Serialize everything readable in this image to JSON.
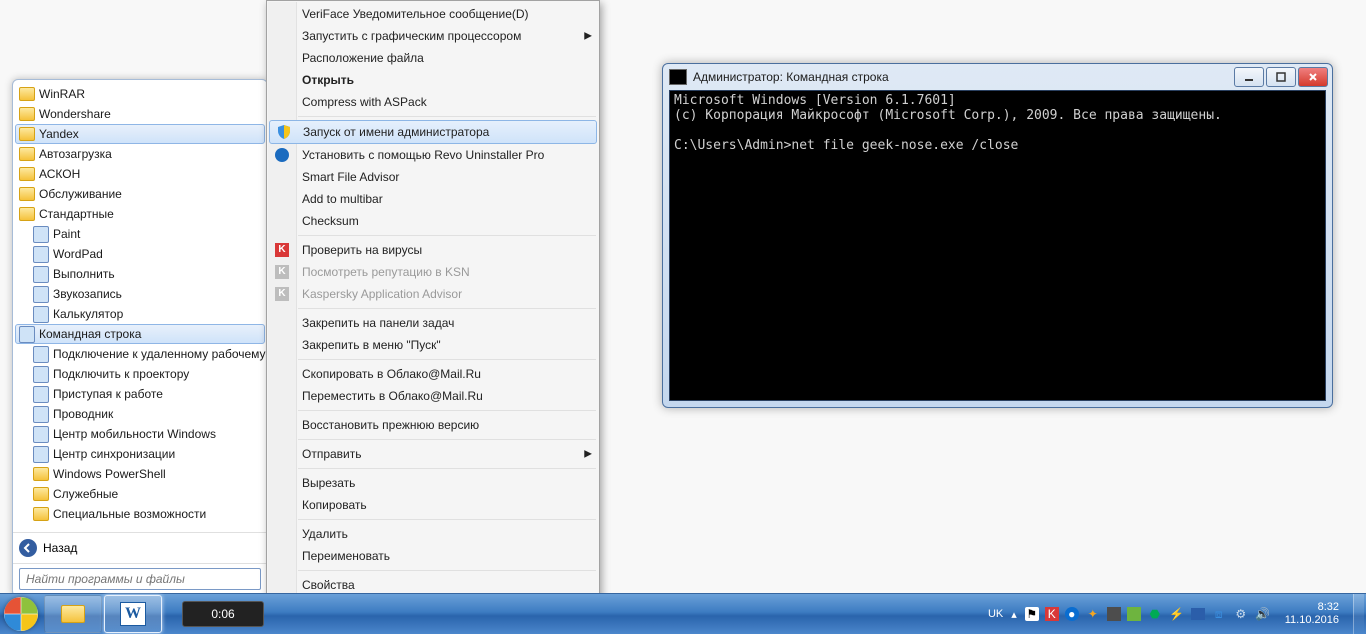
{
  "start_menu": {
    "items": [
      {
        "label": "WinRAR",
        "kind": "folder"
      },
      {
        "label": "Wondershare",
        "kind": "folder"
      },
      {
        "label": "Yandex",
        "kind": "folder",
        "selected": true
      },
      {
        "label": "Автозагрузка",
        "kind": "folder"
      },
      {
        "label": "АСКОН",
        "kind": "folder"
      },
      {
        "label": "Обслуживание",
        "kind": "folder"
      },
      {
        "label": "Стандартные",
        "kind": "folder"
      },
      {
        "label": "Paint",
        "kind": "app",
        "indent": true
      },
      {
        "label": "WordPad",
        "kind": "app",
        "indent": true
      },
      {
        "label": "Выполнить",
        "kind": "app",
        "indent": true
      },
      {
        "label": "Звукозапись",
        "kind": "app",
        "indent": true
      },
      {
        "label": "Калькулятор",
        "kind": "app",
        "indent": true
      },
      {
        "label": "Командная строка",
        "kind": "app",
        "indent": true,
        "selected": true
      },
      {
        "label": "Подключение к удаленному рабочему",
        "kind": "app",
        "indent": true
      },
      {
        "label": "Подключить к проектору",
        "kind": "app",
        "indent": true
      },
      {
        "label": "Приступая к работе",
        "kind": "app",
        "indent": true
      },
      {
        "label": "Проводник",
        "kind": "app",
        "indent": true
      },
      {
        "label": "Центр мобильности Windows",
        "kind": "app",
        "indent": true
      },
      {
        "label": "Центр синхронизации",
        "kind": "app",
        "indent": true
      },
      {
        "label": "Windows PowerShell",
        "kind": "folder",
        "indent": true
      },
      {
        "label": "Служебные",
        "kind": "folder",
        "indent": true
      },
      {
        "label": "Специальные возможности",
        "kind": "folder",
        "indent": true
      }
    ],
    "back_label": "Назад",
    "search_placeholder": "Найти программы и файлы"
  },
  "context_menu": {
    "items": [
      {
        "label": "VeriFace Уведомительное сообщение(D)"
      },
      {
        "label": "Запустить с графическим процессором",
        "submenu": true
      },
      {
        "label": "Расположение файла"
      },
      {
        "label": "Открыть",
        "bold": true
      },
      {
        "label": "Compress with ASPack"
      },
      {
        "sep": true
      },
      {
        "label": "Запуск от имени администратора",
        "highlight": true,
        "icon": "shield-icon"
      },
      {
        "label": "Установить с помощью Revo Uninstaller Pro",
        "icon": "revo-icon"
      },
      {
        "label": "Smart File Advisor"
      },
      {
        "label": "Add to multibar"
      },
      {
        "label": "Checksum"
      },
      {
        "sep": true
      },
      {
        "label": "Проверить на вирусы",
        "icon": "kaspersky-icon"
      },
      {
        "label": "Посмотреть репутацию в KSN",
        "disabled": true,
        "icon": "kaspersky-gray-icon"
      },
      {
        "label": "Kaspersky Application Advisor",
        "disabled": true,
        "icon": "kaspersky-gray-icon"
      },
      {
        "sep": true
      },
      {
        "label": "Закрепить на панели задач"
      },
      {
        "label": "Закрепить в меню \"Пуск\""
      },
      {
        "sep": true
      },
      {
        "label": "Скопировать в Облако@Mail.Ru"
      },
      {
        "label": "Переместить в Облако@Mail.Ru"
      },
      {
        "sep": true
      },
      {
        "label": "Восстановить прежнюю версию"
      },
      {
        "sep": true
      },
      {
        "label": "Отправить",
        "submenu": true
      },
      {
        "sep": true
      },
      {
        "label": "Вырезать"
      },
      {
        "label": "Копировать"
      },
      {
        "sep": true
      },
      {
        "label": "Удалить"
      },
      {
        "label": "Переименовать"
      },
      {
        "sep": true
      },
      {
        "label": "Свойства"
      }
    ]
  },
  "cmd_window": {
    "title": "Администратор: Командная строка",
    "line1": "Microsoft Windows [Version 6.1.7601]",
    "line2": "(c) Корпорация Майкрософт (Microsoft Corp.), 2009. Все права защищены.",
    "blank": "",
    "prompt": "C:\\Users\\Admin>net file geek-nose.exe /close"
  },
  "taskbar": {
    "media_time": "0:06",
    "lang": "UK",
    "time": "8:32",
    "date": "11.10.2016"
  }
}
